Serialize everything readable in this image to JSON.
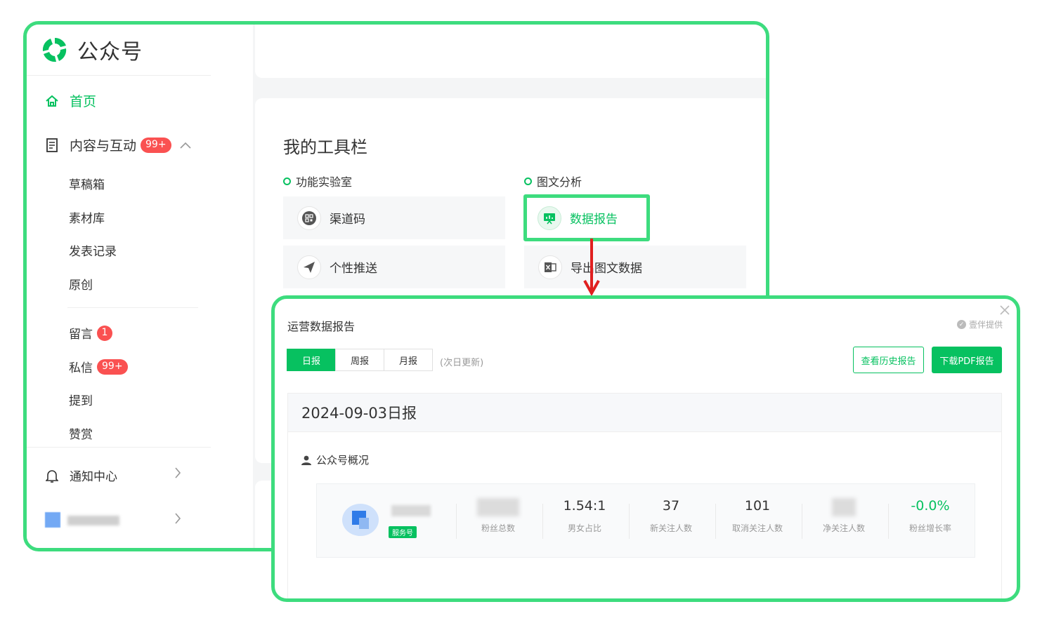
{
  "app": {
    "name": "公众号"
  },
  "sidebar": {
    "home": "首页",
    "content": {
      "label": "内容与互动",
      "badge": "99+"
    },
    "content_items": [
      "草稿箱",
      "素材库",
      "发表记录",
      "原创"
    ],
    "interact_items": [
      {
        "label": "留言",
        "badge": "1"
      },
      {
        "label": "私信",
        "badge": "99+"
      },
      {
        "label": "提到"
      },
      {
        "label": "赞赏"
      }
    ],
    "notify": "通知中心"
  },
  "toolbar": {
    "title": "我的工具栏",
    "sections": [
      "功能实验室",
      "图文分析"
    ],
    "tools": [
      "渠道码",
      "个性推送",
      "数据报告",
      "导出图文数据"
    ]
  },
  "report_dialog": {
    "title": "运营数据报告",
    "provider": "壹伴提供",
    "tabs": [
      "日报",
      "周报",
      "月报"
    ],
    "active_tab": "日报",
    "tab_note": "(次日更新)",
    "history_button": "查看历史报告",
    "pdf_button": "下载PDF报告",
    "report_title": "2024-09-03日报",
    "overview_label": "公众号概况",
    "account_tag": "服务号",
    "stats": [
      {
        "value": "",
        "label": "粉丝总数"
      },
      {
        "value": "1.54:1",
        "label": "男女占比"
      },
      {
        "value": "37",
        "label": "新关注人数"
      },
      {
        "value": "101",
        "label": "取消关注人数"
      },
      {
        "value": "",
        "label": "净关注人数"
      },
      {
        "value": "-0.0%",
        "label": "粉丝增长率"
      }
    ]
  },
  "colors": {
    "accent": "#07c160",
    "highlight": "#3ddc7e",
    "badge": "#fa5151",
    "arrow": "#e02020"
  }
}
